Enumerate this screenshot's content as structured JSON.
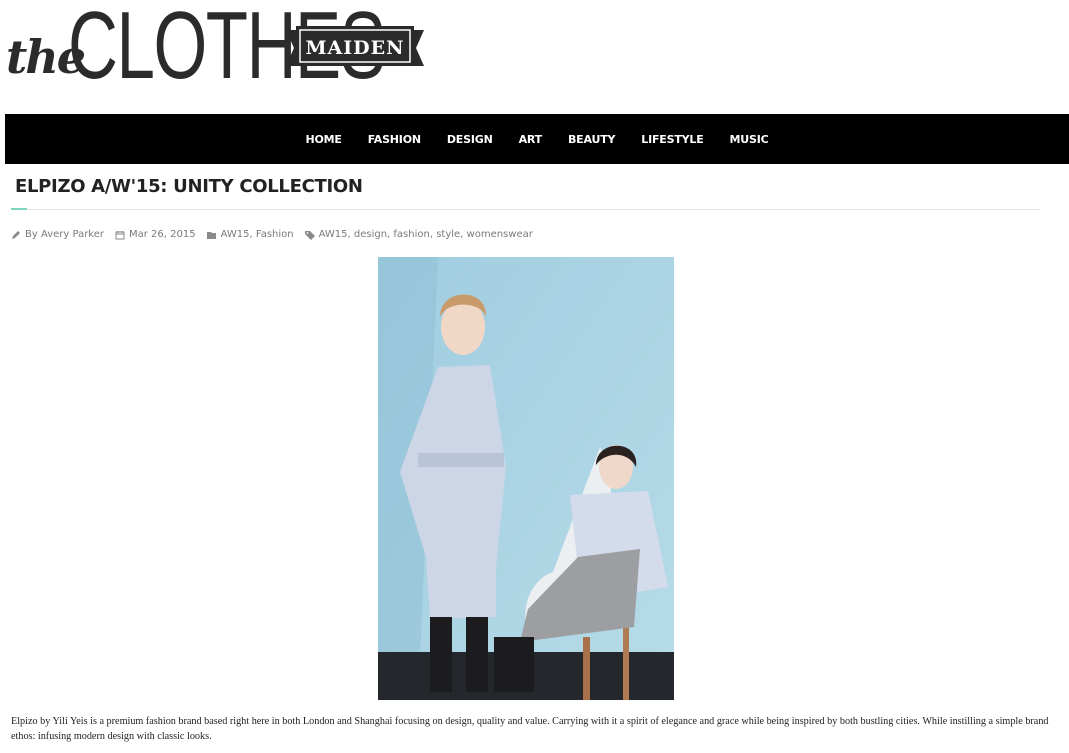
{
  "logo": {
    "the": "the",
    "clothes": "CLOTHES",
    "maiden": "MAIDEN"
  },
  "nav": {
    "items": [
      "HOME",
      "FASHION",
      "DESIGN",
      "ART",
      "BEAUTY",
      "LIFESTYLE",
      "MUSIC"
    ]
  },
  "post": {
    "title": "ELPIZO A/W'15: UNITY COLLECTION",
    "author": "By Avery Parker",
    "date": "Mar 26, 2015",
    "categories": "AW15, Fashion",
    "tags": "AW15, design, fashion, style, womenswear",
    "body": "Elpizo by Yili Yeis is a premium fashion brand based right here in both London and Shanghai focusing on design, quality and value. Carrying with it a spirit of elegance and grace while being inspired by both bustling cities. While instilling a simple brand ethos: infusing modern design with classic looks."
  },
  "colors": {
    "nav_bg": "#000000",
    "accent": "#7fd6c0",
    "photo_bg": "#a9d3e3"
  },
  "icons": [
    "pencil-icon",
    "calendar-icon",
    "folder-icon",
    "tag-icon"
  ]
}
